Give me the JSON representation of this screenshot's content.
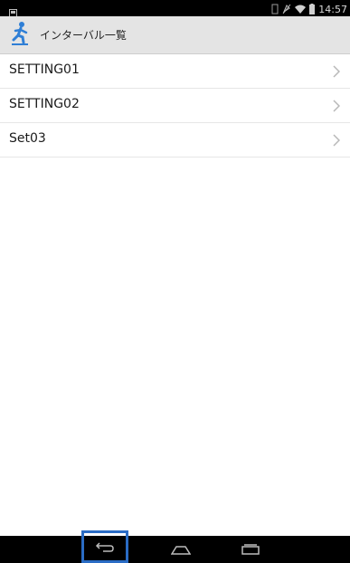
{
  "status_bar": {
    "time": "14:57",
    "icons": [
      "notification-icon",
      "vibrate-icon",
      "wifi-icon",
      "battery-icon"
    ]
  },
  "action_bar": {
    "title": "インターバル一覧",
    "logo_icon": "runner-logo-icon"
  },
  "list": {
    "items": [
      {
        "label": "SETTING01"
      },
      {
        "label": "SETTING02"
      },
      {
        "label": "Set03"
      }
    ]
  },
  "nav_bar": {
    "buttons": [
      "back-icon",
      "home-icon",
      "recents-icon"
    ],
    "highlight_color": "#2a6cc5"
  }
}
